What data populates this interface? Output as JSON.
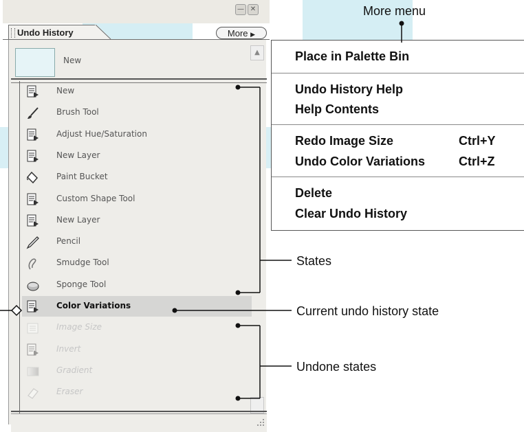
{
  "palette": {
    "tab_label": "Undo History",
    "more_label": "More",
    "snapshot_label": "New",
    "states": [
      {
        "label": "New",
        "icon": "document-icon",
        "status": "normal"
      },
      {
        "label": "Brush Tool",
        "icon": "brush-icon",
        "status": "normal"
      },
      {
        "label": "Adjust Hue/Saturation",
        "icon": "document-icon",
        "status": "normal"
      },
      {
        "label": "New Layer",
        "icon": "document-icon",
        "status": "normal"
      },
      {
        "label": "Paint Bucket",
        "icon": "paint-bucket-icon",
        "status": "normal"
      },
      {
        "label": "Custom Shape Tool",
        "icon": "document-icon",
        "status": "normal"
      },
      {
        "label": "New Layer",
        "icon": "document-icon",
        "status": "normal"
      },
      {
        "label": "Pencil",
        "icon": "pencil-icon",
        "status": "normal"
      },
      {
        "label": "Smudge Tool",
        "icon": "smudge-icon",
        "status": "normal"
      },
      {
        "label": "Sponge Tool",
        "icon": "sponge-icon",
        "status": "normal"
      },
      {
        "label": "Color Variations",
        "icon": "document-icon",
        "status": "current"
      },
      {
        "label": "Image Size",
        "icon": "image-size-icon",
        "status": "undone"
      },
      {
        "label": "Invert",
        "icon": "document-icon",
        "status": "undone"
      },
      {
        "label": "Gradient",
        "icon": "gradient-icon",
        "status": "undone"
      },
      {
        "label": "Eraser",
        "icon": "eraser-icon",
        "status": "undone"
      }
    ]
  },
  "more_menu": {
    "items": [
      {
        "label": "Place in Palette Bin",
        "shortcut": ""
      },
      {
        "label": "Undo History Help",
        "shortcut": ""
      },
      {
        "label": "Help Contents",
        "shortcut": ""
      },
      {
        "label": "Redo Image Size",
        "shortcut": "Ctrl+Y"
      },
      {
        "label": "Undo Color Variations",
        "shortcut": "Ctrl+Z"
      },
      {
        "label": "Delete",
        "shortcut": ""
      },
      {
        "label": "Clear Undo History",
        "shortcut": ""
      }
    ]
  },
  "callouts": {
    "more_menu": "More menu",
    "states": "States",
    "current_state": "Current undo history state",
    "undone_states": "Undone states"
  },
  "colors": {
    "watermark": "#cfe9f1",
    "current_row": "#d6d6d4",
    "panel": "#eeede9"
  }
}
